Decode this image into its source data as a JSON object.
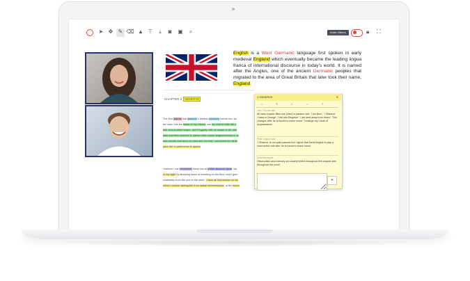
{
  "toolbar": {
    "invite_label": "Invite Others",
    "record_label": "REC",
    "tool_icons": [
      "record-icon",
      "pointer-icon",
      "move-icon",
      "pen-icon",
      "eraser-icon",
      "shapes-icon",
      "filter-icon",
      "download-icon",
      "camera-icon",
      "image-icon",
      "search-icon"
    ],
    "right_icons": [
      "lock-icon",
      "fullscreen-icon"
    ]
  },
  "document": {
    "intro_parts": [
      {
        "t": "English",
        "hl": "y"
      },
      {
        "t": " is a "
      },
      {
        "t": "West Germanic",
        "hl": "red"
      },
      {
        "t": " language  first spoken in early medieval "
      },
      {
        "t": "England",
        "hl": "y"
      },
      {
        "t": " which eventually  became the leading lingua franca of international discourse in today's world. It is named after the Angles, one of the ancient "
      },
      {
        "t": "Germanic",
        "hl": "red"
      },
      {
        "t": " peoples that migrated to the area of Great Britain that later took their name, "
      },
      {
        "t": "England",
        "hl": "y"
      },
      {
        "t": "."
      }
    ],
    "chapter_label": "CHAPTER 2",
    "chapter_tag": "OBSERVE",
    "para1_lines": [
      [
        {
          "t": "The first "
        },
        {
          "t": "objects",
          "hl": "p"
        },
        {
          "t": " that "
        },
        {
          "t": "assume",
          "hl": "b"
        },
        {
          "t": " a distinct "
        },
        {
          "t": "presence",
          "hl": "b"
        },
        {
          "t": " before me, as"
        }
      ],
      [
        {
          "t": "far back, into the "
        },
        {
          "t": "blank of my infancy",
          "hl": "g"
        },
        {
          "t": ", are "
        },
        {
          "t": "my mother with her p",
          "hl": "g"
        }
      ],
      [
        {
          "t": "hair and youthful shape, and Peggotty with no shape at all, and",
          "hl": "g"
        }
      ],
      [
        {
          "t": "dark that they seemed to darken their whole neighbourhood in fa",
          "hl": "g"
        }
      ],
      [
        {
          "t": "and cheeks and arms so hard and red that I wondered the birds",
          "hl": "g"
        }
      ],
      [
        {
          "t": "peck her in preference to ",
          "hl": "y"
        },
        {
          "t": "apples",
          "hl": "y"
        }
      ]
    ],
    "para2_lines": [
      [
        {
          "t": "I believe I can "
        },
        {
          "t": "remember",
          "hl": "v"
        },
        {
          "t": " these two at "
        },
        {
          "t": "a little distance apart",
          "hl": "v"
        },
        {
          "t": ", dw"
        }
      ],
      [
        {
          "t": "to my sight",
          "hl": "y"
        },
        {
          "t": " by stooping down or kneeling on the floor, and I goin"
        }
      ],
      [
        {
          "t": "unsteadily from the one to the other. "
        },
        {
          "t": "I have an impression on my",
          "hl": "y"
        }
      ],
      [
        {
          "t": "which I cannot distinguish from actual remembrance",
          "hl": "y"
        },
        {
          "t": ", of the "
        },
        {
          "t": "touch",
          "hl": "y"
        }
      ]
    ]
  },
  "comments": {
    "title": "1 OBSERVE",
    "close": "✕",
    "tabs": [
      "☺",
      "✎",
      "⌕",
      "✓",
      "≡"
    ],
    "items": [
      {
        "author": "John Thomas said",
        "text": "All early chapter titles use David in passive role: 'I am Born', 'I Observe' 'I have a Change', 'I fall into Disgrace'; 'I am sent away from Home'. This changes after he is forced to leave home: 'I enlarge my Circle of Acquaintance'."
      },
      {
        "author": "Peter Hughes said",
        "text": "'I Observe' is not quite passive but I agree that David begins to play a more active role after he is forced to leave home."
      },
      {
        "author": "Sarah Marquaist",
        "text": "Observation and memory are closely linked throughout this chapter and throughout the novel."
      }
    ],
    "reply_placeholder": "",
    "send_icon": "send-icon"
  },
  "colors": {
    "accent": "#fff23d",
    "highlight_red": "#e5333a",
    "video_border": "#27306b",
    "panel_bg": "#fffbd1"
  }
}
